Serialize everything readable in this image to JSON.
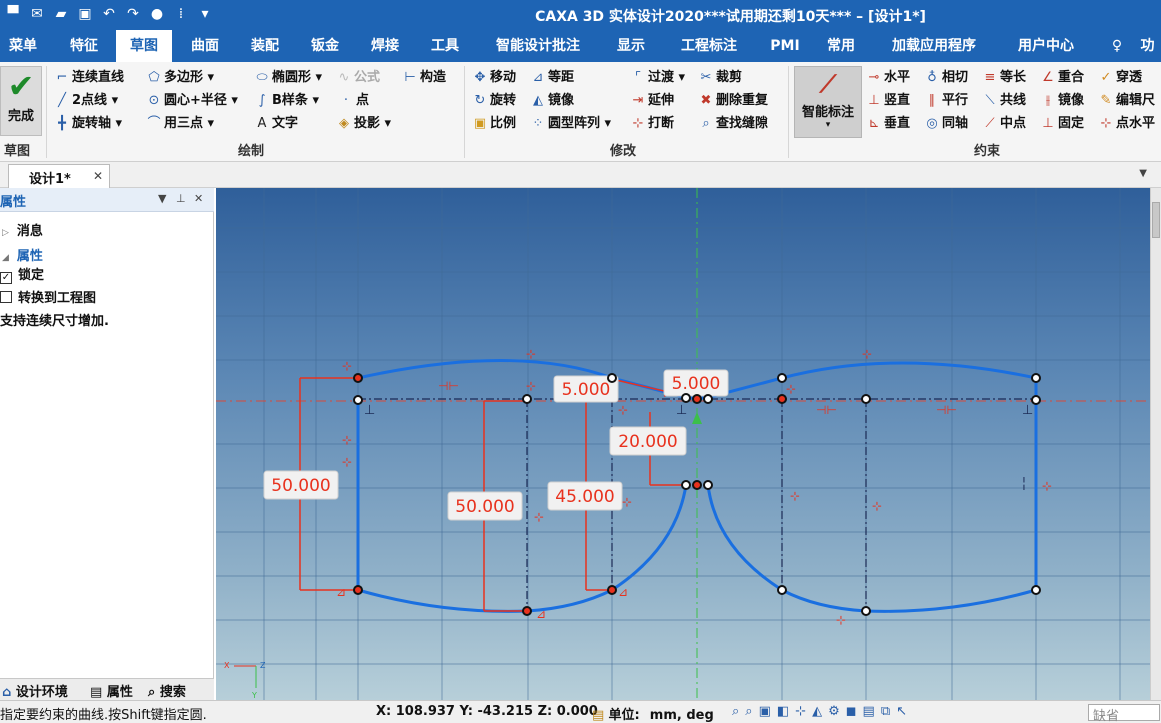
{
  "window": {
    "title": "CAXA 3D 实体设计2020***试用期还剩10天*** – [设计1*]"
  },
  "menu_tabs": [
    "菜单",
    "特征",
    "草图",
    "曲面",
    "装配",
    "钣金",
    "焊接",
    "工具",
    "智能设计批注",
    "显示",
    "工程标注",
    "PMI",
    "常用",
    "加载应用程序",
    "用户中心"
  ],
  "menu_active": "草图",
  "menu_right": "功",
  "ribbon": {
    "finish_label": "完成",
    "sketch_group": "草图",
    "draw_group": "绘制",
    "modify_group": "修改",
    "constraint_group": "约束",
    "smart_dim": "智能标注",
    "draw": {
      "line": "连续直线",
      "polygon": "多边形",
      "ellipse": "椭圆形",
      "formula": "公式",
      "construct": "构造",
      "two_point_line": "2点线",
      "circle_center_radius": "圆心+半径",
      "bspline": "B样条",
      "point": "点",
      "rotate_axis": "旋转轴",
      "three_point_arc": "用三点",
      "text": "文字",
      "project": "投影"
    },
    "modify": {
      "move": "移动",
      "offset": "等距",
      "fillet": "过渡",
      "trim": "裁剪",
      "rotate": "旋转",
      "mirror": "镜像",
      "extend": "延伸",
      "delete_dup": "删除重复",
      "scale": "比例",
      "circular_array": "圆型阵列",
      "break": "打断",
      "find_gap": "查找缝隙"
    },
    "constraint": {
      "horizontal": "水平",
      "tangent": "相切",
      "equal": "等长",
      "coincident": "重合",
      "pierce": "穿透",
      "vertical": "竖直",
      "parallel": "平行",
      "collinear": "共线",
      "mirror": "镜像",
      "edit_dim": "编辑尺",
      "perpendicular": "垂直",
      "concentric": "同轴",
      "midpoint": "中点",
      "fixed": "固定",
      "point_horizontal": "点水平"
    }
  },
  "doc_tab": "设计1*",
  "panel": {
    "title": "属性",
    "messages": "消息",
    "properties": "属性",
    "lock": "锁定",
    "to_drawing": "转换到工程图",
    "hint": "支持连续尺寸增加.",
    "bottom_tabs": [
      "设计环境",
      "属性",
      "搜索"
    ]
  },
  "canvas": {
    "dimensions": [
      "50.000",
      "50.000",
      "45.000",
      "5.000",
      "5.000",
      "20.000"
    ],
    "sketch_color": "#1a6fe0",
    "dim_color": "#e8321e",
    "triad_labels": [
      "X",
      "Z",
      "Y"
    ]
  },
  "status": {
    "prompt": "指定要约束的曲线.按Shift键指定圆.",
    "coords": "X: 108.937 Y: -43.215 Z: 0.000",
    "units_label": "单位:",
    "units_value": "mm, deg",
    "mode": "缺省"
  }
}
